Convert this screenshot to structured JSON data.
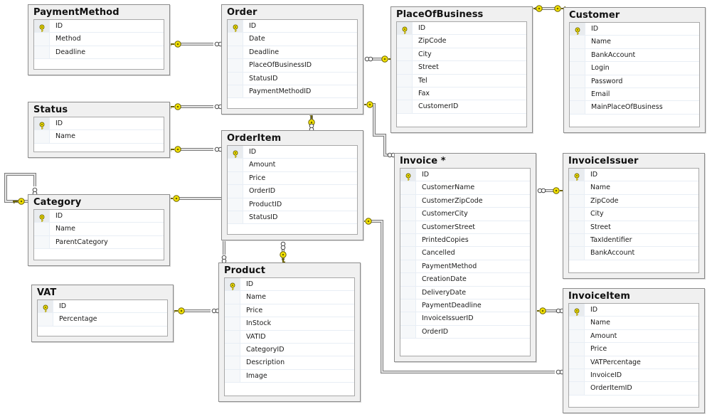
{
  "diagram": {
    "type": "database-schema",
    "tables": {
      "PaymentMethod": {
        "title": "PaymentMethod",
        "columns": [
          {
            "name": "ID",
            "pk": true
          },
          {
            "name": "Method"
          },
          {
            "name": "Deadline"
          }
        ]
      },
      "Status": {
        "title": "Status",
        "columns": [
          {
            "name": "ID",
            "pk": true
          },
          {
            "name": "Name"
          }
        ]
      },
      "Category": {
        "title": "Category",
        "columns": [
          {
            "name": "ID",
            "pk": true
          },
          {
            "name": "Name"
          },
          {
            "name": "ParentCategory"
          }
        ]
      },
      "VAT": {
        "title": "VAT",
        "columns": [
          {
            "name": "ID",
            "pk": true
          },
          {
            "name": "Percentage"
          }
        ]
      },
      "Order": {
        "title": "Order",
        "columns": [
          {
            "name": "ID",
            "pk": true
          },
          {
            "name": "Date"
          },
          {
            "name": "Deadline"
          },
          {
            "name": "PlaceOfBusinessID"
          },
          {
            "name": "StatusID"
          },
          {
            "name": "PaymentMethodID"
          }
        ]
      },
      "OrderItem": {
        "title": "OrderItem",
        "columns": [
          {
            "name": "ID",
            "pk": true
          },
          {
            "name": "Amount"
          },
          {
            "name": "Price"
          },
          {
            "name": "OrderID"
          },
          {
            "name": "ProductID"
          },
          {
            "name": "StatusID"
          }
        ]
      },
      "Product": {
        "title": "Product",
        "columns": [
          {
            "name": "ID",
            "pk": true
          },
          {
            "name": "Name"
          },
          {
            "name": "Price"
          },
          {
            "name": "InStock"
          },
          {
            "name": "VATID"
          },
          {
            "name": "CategoryID"
          },
          {
            "name": "Description"
          },
          {
            "name": "Image"
          }
        ]
      },
      "PlaceOfBusiness": {
        "title": "PlaceOfBusiness",
        "columns": [
          {
            "name": "ID",
            "pk": true
          },
          {
            "name": "ZipCode"
          },
          {
            "name": "City"
          },
          {
            "name": "Street"
          },
          {
            "name": "Tel"
          },
          {
            "name": "Fax"
          },
          {
            "name": "CustomerID"
          }
        ]
      },
      "Customer": {
        "title": "Customer",
        "columns": [
          {
            "name": "ID",
            "pk": true
          },
          {
            "name": "Name"
          },
          {
            "name": "BankAccount"
          },
          {
            "name": "Login"
          },
          {
            "name": "Password"
          },
          {
            "name": "Email"
          },
          {
            "name": "MainPlaceOfBusiness"
          }
        ]
      },
      "Invoice": {
        "title": "Invoice *",
        "columns": [
          {
            "name": "ID",
            "pk": true
          },
          {
            "name": "CustomerName"
          },
          {
            "name": "CustomerZipCode"
          },
          {
            "name": "CustomerCity"
          },
          {
            "name": "CustomerStreet"
          },
          {
            "name": "PrintedCopies"
          },
          {
            "name": "Cancelled"
          },
          {
            "name": "PaymentMethod"
          },
          {
            "name": "CreationDate"
          },
          {
            "name": "DeliveryDate"
          },
          {
            "name": "PaymentDeadline"
          },
          {
            "name": "InvoiceIssuerID"
          },
          {
            "name": "OrderID"
          }
        ]
      },
      "InvoiceIssuer": {
        "title": "InvoiceIssuer",
        "columns": [
          {
            "name": "ID",
            "pk": true
          },
          {
            "name": "Name"
          },
          {
            "name": "ZipCode"
          },
          {
            "name": "City"
          },
          {
            "name": "Street"
          },
          {
            "name": "TaxIdentifier"
          },
          {
            "name": "BankAccount"
          }
        ]
      },
      "InvoiceItem": {
        "title": "InvoiceItem",
        "columns": [
          {
            "name": "ID",
            "pk": true
          },
          {
            "name": "Name"
          },
          {
            "name": "Amount"
          },
          {
            "name": "Price"
          },
          {
            "name": "VATPercentage"
          },
          {
            "name": "InvoiceID"
          },
          {
            "name": "OrderItemID"
          }
        ]
      }
    },
    "relationships": [
      {
        "from": "PaymentMethod",
        "to": "Order",
        "one": "PaymentMethod",
        "many": "Order"
      },
      {
        "from": "Status",
        "to": "Order",
        "one": "Status",
        "many": "Order"
      },
      {
        "from": "Status",
        "to": "OrderItem",
        "one": "Status",
        "many": "OrderItem"
      },
      {
        "from": "Category",
        "to": "Category",
        "one": "Category",
        "many": "Category",
        "self": true
      },
      {
        "from": "Category",
        "to": "Product",
        "one": "Category",
        "many": "Product"
      },
      {
        "from": "VAT",
        "to": "Product",
        "one": "VAT",
        "many": "Product"
      },
      {
        "from": "Order",
        "to": "OrderItem",
        "one": "Order",
        "many": "OrderItem"
      },
      {
        "from": "Product",
        "to": "OrderItem",
        "one": "Product",
        "many": "OrderItem"
      },
      {
        "from": "PlaceOfBusiness",
        "to": "Order",
        "one": "PlaceOfBusiness",
        "many": "Order"
      },
      {
        "from": "PlaceOfBusiness",
        "to": "Customer",
        "one": "PlaceOfBusiness",
        "many": "Customer",
        "one_to_one": true
      },
      {
        "from": "Order",
        "to": "Invoice",
        "one": "Order",
        "many": "Invoice"
      },
      {
        "from": "InvoiceIssuer",
        "to": "Invoice",
        "one": "InvoiceIssuer",
        "many": "Invoice"
      },
      {
        "from": "Invoice",
        "to": "InvoiceItem",
        "one": "Invoice",
        "many": "InvoiceItem"
      },
      {
        "from": "OrderItem",
        "to": "InvoiceItem",
        "one": "OrderItem",
        "many": "InvoiceItem"
      }
    ],
    "icons": {
      "primary_key": "key-icon",
      "one_end": "key-icon",
      "many_end": "infinity-icon"
    },
    "colors": {
      "key_yellow": "#f5e400",
      "line": "#8a8a8a",
      "table_bg": "#f0f0f0",
      "table_border": "#8c8c8c"
    }
  }
}
